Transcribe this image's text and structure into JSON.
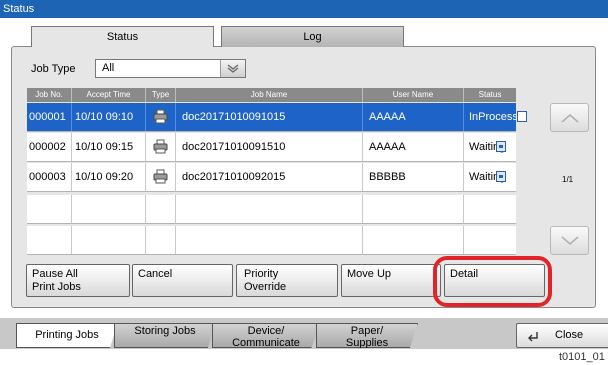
{
  "window": {
    "title": "Status"
  },
  "tabs": [
    {
      "label": "Status",
      "active": true
    },
    {
      "label": "Log",
      "active": false
    }
  ],
  "filter": {
    "label": "Job Type",
    "value": "All"
  },
  "table": {
    "headers": [
      "Job No.",
      "Accept Time",
      "Type",
      "Job Name",
      "User Name",
      "Status"
    ],
    "rows": [
      {
        "job_no": "000001",
        "time": "10/10 09:10",
        "type_icon": "printer-icon",
        "name": "doc20171010091015",
        "user": "AAAAA",
        "status": "InProcess",
        "selected": true
      },
      {
        "job_no": "000002",
        "time": "10/10 09:15",
        "type_icon": "printer-icon",
        "name": "doc20171010091510",
        "user": "AAAAA",
        "status": "Waiting",
        "selected": false
      },
      {
        "job_no": "000003",
        "time": "10/10 09:20",
        "type_icon": "printer-icon",
        "name": "doc20171010092015",
        "user": "BBBBB",
        "status": "Waiting",
        "selected": false
      }
    ],
    "page_indicator": "1/1"
  },
  "actions": {
    "pause_all": [
      "Pause All",
      "Print Jobs"
    ],
    "cancel": "Cancel",
    "priority_override": [
      "Priority",
      "Override"
    ],
    "move_up": "Move Up",
    "detail": "Detail"
  },
  "bottom_tabs": [
    {
      "label": [
        "Printing Jobs"
      ],
      "active": true
    },
    {
      "label": [
        "Storing Jobs"
      ],
      "active": false
    },
    {
      "label": [
        "Device/",
        "Communicate"
      ],
      "active": false
    },
    {
      "label": [
        "Paper/",
        "Supplies"
      ],
      "active": false
    }
  ],
  "close_label": "Close",
  "figure_id": "t0101_01",
  "colors": {
    "title_bar": "#1e64b4",
    "selected_row": "#1e64c8",
    "highlight": "#e0252a"
  }
}
